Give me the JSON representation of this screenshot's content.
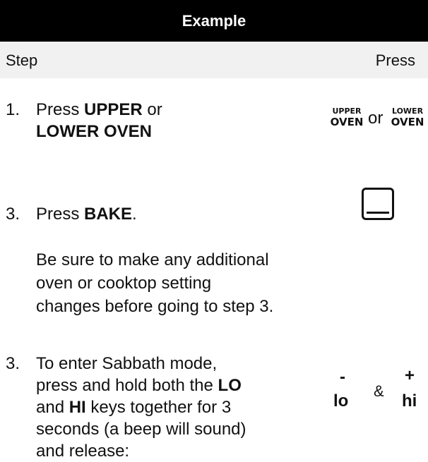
{
  "header": {
    "title": "Example"
  },
  "columns": {
    "step": "Step",
    "press": "Press"
  },
  "steps": [
    {
      "number": "1.",
      "lines": [
        "Press ",
        "UPPER",
        " or",
        "LOWER OVEN"
      ],
      "keys": {
        "upper_top": "UPPER",
        "upper_bottom": "OVEN",
        "or": "or",
        "lower_top": "LOWER",
        "lower_bottom": "OVEN"
      }
    },
    {
      "number": "3.",
      "press": "Press ",
      "bold": "BAKE",
      "after": ".",
      "note": [
        "Be sure to make any additional",
        "oven or cooktop setting",
        "changes before going to step 3."
      ],
      "keys": {
        "bake_icon": "bake-icon"
      }
    },
    {
      "number": "3.",
      "lines": [
        "To enter Sabbath mode,",
        "press and hold both the ",
        "LO",
        "and ",
        "HI",
        " keys together for 3",
        "seconds (a beep will sound)",
        "and release:"
      ],
      "keys": {
        "minus": "-",
        "lo": "lo",
        "amp": "&",
        "plus": "+",
        "hi": "hi"
      }
    }
  ]
}
